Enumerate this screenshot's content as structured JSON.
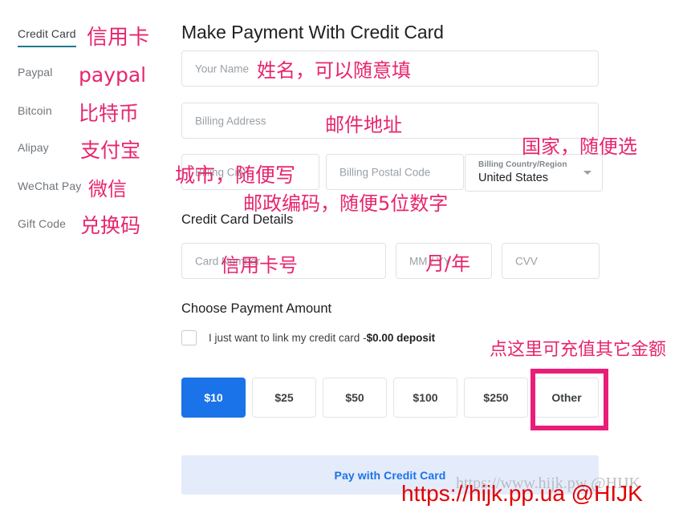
{
  "sidebar": {
    "items": [
      {
        "label": "Credit Card",
        "note": "信用卡",
        "active": true
      },
      {
        "label": "Paypal",
        "note": "paypal",
        "active": false
      },
      {
        "label": "Bitcoin",
        "note": "比特币",
        "active": false
      },
      {
        "label": "Alipay",
        "note": "支付宝",
        "active": false
      },
      {
        "label": "WeChat Pay",
        "note": "微信",
        "active": false
      },
      {
        "label": "Gift Code",
        "note": "兑换码",
        "active": false
      }
    ]
  },
  "main": {
    "page_title": "Make Payment With Credit Card",
    "credit_card_details_title": "Credit Card Details",
    "choose_amount_title": "Choose Payment Amount",
    "fields": {
      "name_placeholder": "Your Name",
      "address_placeholder": "Billing Address",
      "city_placeholder": "Billing City",
      "postal_placeholder": "Billing Postal Code",
      "country_label": "Billing Country/Region",
      "country_value": "United States",
      "card_number_placeholder": "Card Number",
      "expiry_placeholder": "MM / YY",
      "cvv_placeholder": "CVV"
    },
    "deposit": {
      "text": "I just want to link my credit card -",
      "amount": "$0.00 deposit",
      "checked": false
    },
    "amounts": [
      {
        "label": "$10",
        "selected": true
      },
      {
        "label": "$25",
        "selected": false
      },
      {
        "label": "$50",
        "selected": false
      },
      {
        "label": "$100",
        "selected": false
      },
      {
        "label": "$250",
        "selected": false
      },
      {
        "label": "Other",
        "selected": false
      }
    ],
    "pay_button_label": "Pay with Credit Card"
  },
  "annotations": {
    "name": "姓名，可以随意填",
    "address": "邮件地址",
    "country": "国家，随便选",
    "city": "城市，随便写",
    "postal": "邮政编码，随便5位数字",
    "card_number": "信用卡号",
    "expiry": "月/年",
    "other_amount": "点这里可充值其它金额"
  },
  "watermarks": {
    "grey": "https://www.hijk.pw @HIJK",
    "red": "https://hijk.pp.ua @HIJK"
  },
  "colors": {
    "accent_blue": "#1a73e8",
    "annotation_pink": "#e8256e",
    "highlight_pink": "#e91e78",
    "tab_underline": "#1f7a8c",
    "watermark_red": "#e00000"
  }
}
